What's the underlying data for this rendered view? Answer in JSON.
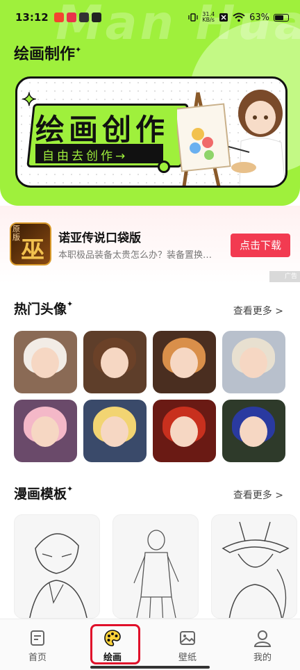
{
  "status_bar": {
    "time": "13:12",
    "net_speed_value": "31.4",
    "net_speed_unit": "KB/s",
    "battery": "63%"
  },
  "header": {
    "watermark": "Man Hua",
    "title": "绘画制作"
  },
  "banner": {
    "title": "绘画创作",
    "subtitle": "自由去创作→"
  },
  "ad": {
    "icon_tag": "原版",
    "title": "诺亚传说口袋版",
    "description": "本职极品装备太贵怎么办？装备置换…",
    "button": "点击下载",
    "label": "广告"
  },
  "hot_avatars": {
    "title": "热门头像",
    "see_more": "查看更多 >",
    "items": [
      {
        "name": "avatar-1",
        "bg": "#8a6a55",
        "hair": "#f2ece6"
      },
      {
        "name": "avatar-2",
        "bg": "#5e3e2a",
        "hair": "#6b4128"
      },
      {
        "name": "avatar-3",
        "bg": "#4a2e20",
        "hair": "#d98f4a"
      },
      {
        "name": "avatar-4",
        "bg": "#b8c0cc",
        "hair": "#e8e0d0"
      },
      {
        "name": "avatar-5",
        "bg": "#6a4a6a",
        "hair": "#f4b8c8"
      },
      {
        "name": "avatar-6",
        "bg": "#3a4a6a",
        "hair": "#f2d472"
      },
      {
        "name": "avatar-7",
        "bg": "#6a1a14",
        "hair": "#c8301e"
      },
      {
        "name": "avatar-8",
        "bg": "#2e3a2a",
        "hair": "#2a3aa0"
      }
    ]
  },
  "comic_templates": {
    "title": "漫画模板",
    "see_more": "查看更多 >"
  },
  "tab_bar": {
    "tabs": [
      {
        "label": "首页",
        "icon": "home-icon"
      },
      {
        "label": "绘画",
        "icon": "palette-icon"
      },
      {
        "label": "壁纸",
        "icon": "image-icon"
      },
      {
        "label": "我的",
        "icon": "user-icon"
      }
    ],
    "active": "绘画"
  },
  "colors": {
    "accent": "#9ff03c",
    "ad_button": "#f23b51",
    "highlight": "#e0102a"
  }
}
